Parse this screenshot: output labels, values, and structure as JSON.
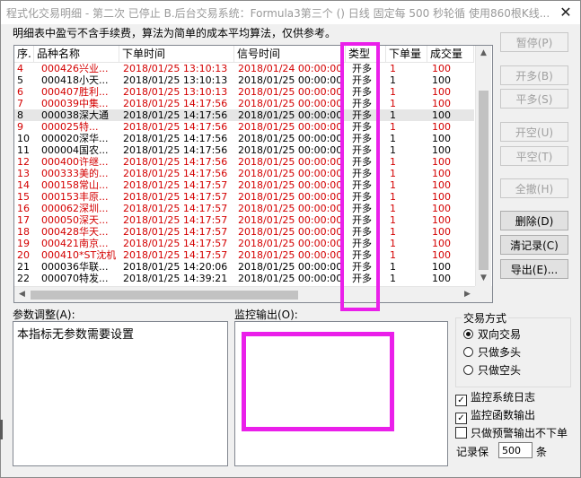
{
  "window": {
    "title": "程式化交易明细 - 第二次 已停止  B.后台交易系统：Formula3第三个 () 日线 固定每 500 秒轮循 使用860根K线...",
    "close_glyph": "✕"
  },
  "info_text": "明细表中盈亏不含手续费，算法为简单的成本平均算法，仅供参考。",
  "table": {
    "columns": [
      "序.",
      "品种名称",
      "下单时间",
      "信号时间",
      "类型",
      "下单量",
      "成交量"
    ],
    "rows": [
      {
        "seq": "4",
        "name": "000426兴业...",
        "order_time": "2018/01/25  13:10:13",
        "signal_time": "2018/01/24  00:00:00",
        "type": "开多",
        "order_qty": "1",
        "fill_qty": "100",
        "color": "red"
      },
      {
        "seq": "5",
        "name": "000418小天...",
        "order_time": "2018/01/25  13:10:13",
        "signal_time": "2018/01/25  00:00:00",
        "type": "开多",
        "order_qty": "1",
        "fill_qty": "100",
        "color": "black"
      },
      {
        "seq": "6",
        "name": "000407胜利...",
        "order_time": "2018/01/25  13:10:13",
        "signal_time": "2018/01/25  00:00:00",
        "type": "开多",
        "order_qty": "1",
        "fill_qty": "100",
        "color": "red"
      },
      {
        "seq": "7",
        "name": "000039中集...",
        "order_time": "2018/01/25  14:17:56",
        "signal_time": "2018/01/25  00:00:00",
        "type": "开多",
        "order_qty": "1",
        "fill_qty": "100",
        "color": "red"
      },
      {
        "seq": "8",
        "name": "000038深大通",
        "order_time": "2018/01/25  14:17:56",
        "signal_time": "2018/01/25  00:00:00",
        "type": "开多",
        "order_qty": "1",
        "fill_qty": "100",
        "color": "black",
        "selected": true
      },
      {
        "seq": "9",
        "name": "000025特...",
        "order_time": "2018/01/25  14:17:56",
        "signal_time": "2018/01/25  00:00:00",
        "type": "开多",
        "order_qty": "1",
        "fill_qty": "100",
        "color": "red"
      },
      {
        "seq": "10",
        "name": "000020深华...",
        "order_time": "2018/01/25  14:17:56",
        "signal_time": "2018/01/25  00:00:00",
        "type": "开多",
        "order_qty": "1",
        "fill_qty": "100",
        "color": "black"
      },
      {
        "seq": "11",
        "name": "000004国农...",
        "order_time": "2018/01/25  14:17:56",
        "signal_time": "2018/01/25  00:00:00",
        "type": "开多",
        "order_qty": "1",
        "fill_qty": "100",
        "color": "black"
      },
      {
        "seq": "12",
        "name": "000400许继...",
        "order_time": "2018/01/25  14:17:56",
        "signal_time": "2018/01/25  00:00:00",
        "type": "开多",
        "order_qty": "1",
        "fill_qty": "100",
        "color": "red"
      },
      {
        "seq": "13",
        "name": "000333美的...",
        "order_time": "2018/01/25  14:17:56",
        "signal_time": "2018/01/25  00:00:00",
        "type": "开多",
        "order_qty": "1",
        "fill_qty": "100",
        "color": "red"
      },
      {
        "seq": "14",
        "name": "000158常山...",
        "order_time": "2018/01/25  14:17:57",
        "signal_time": "2018/01/25  00:00:00",
        "type": "开多",
        "order_qty": "1",
        "fill_qty": "100",
        "color": "red"
      },
      {
        "seq": "15",
        "name": "000153丰原...",
        "order_time": "2018/01/25  14:17:57",
        "signal_time": "2018/01/25  00:00:00",
        "type": "开多",
        "order_qty": "1",
        "fill_qty": "100",
        "color": "red"
      },
      {
        "seq": "16",
        "name": "000062深圳...",
        "order_time": "2018/01/25  14:17:57",
        "signal_time": "2018/01/25  00:00:00",
        "type": "开多",
        "order_qty": "1",
        "fill_qty": "100",
        "color": "red"
      },
      {
        "seq": "17",
        "name": "000050深天...",
        "order_time": "2018/01/25  14:17:57",
        "signal_time": "2018/01/25  00:00:00",
        "type": "开多",
        "order_qty": "1",
        "fill_qty": "100",
        "color": "red"
      },
      {
        "seq": "18",
        "name": "000428华天...",
        "order_time": "2018/01/25  14:17:57",
        "signal_time": "2018/01/25  00:00:00",
        "type": "开多",
        "order_qty": "1",
        "fill_qty": "100",
        "color": "red"
      },
      {
        "seq": "19",
        "name": "000421南京...",
        "order_time": "2018/01/25  14:17:57",
        "signal_time": "2018/01/25  00:00:00",
        "type": "开多",
        "order_qty": "1",
        "fill_qty": "100",
        "color": "red"
      },
      {
        "seq": "20",
        "name": "000410*ST沈机",
        "order_time": "2018/01/25  14:17:57",
        "signal_time": "2018/01/25  00:00:00",
        "type": "开多",
        "order_qty": "1",
        "fill_qty": "100",
        "color": "red"
      },
      {
        "seq": "21",
        "name": "000036华联...",
        "order_time": "2018/01/25  14:20:06",
        "signal_time": "2018/01/25  00:00:00",
        "type": "开多",
        "order_qty": "1",
        "fill_qty": "100",
        "color": "black"
      },
      {
        "seq": "22",
        "name": "000070特发...",
        "order_time": "2018/01/25  14:39:21",
        "signal_time": "2018/01/25  00:00:00",
        "type": "开多",
        "order_qty": "1",
        "fill_qty": "100",
        "color": "black"
      }
    ]
  },
  "buttons": {
    "pause": "暂停(P)",
    "open_long": "开多(B)",
    "close_long": "平多(S)",
    "open_short": "开空(U)",
    "close_short": "平空(T)",
    "close_all": "全撤(H)",
    "delete": "删除(D)",
    "clear_record": "清记录(C)",
    "export": "导出(E)..."
  },
  "params": {
    "label": "参数调整(A):",
    "text": "本指标无参数需要设置"
  },
  "monitor": {
    "label": "监控输出(O):"
  },
  "trade_mode": {
    "label": "交易方式",
    "options": [
      "双向交易",
      "只做多头",
      "只做空头"
    ],
    "selected_index": 0
  },
  "checkboxes": [
    {
      "label": "监控系统日志",
      "checked": true
    },
    {
      "label": "监控函数输出",
      "checked": true
    },
    {
      "label": "只做预警输出不下单",
      "checked": false
    }
  ],
  "record": {
    "label": "记录保",
    "value": "500",
    "unit": "条"
  },
  "colors": {
    "highlight": "#ea1fea",
    "red_row": "#d40000"
  }
}
